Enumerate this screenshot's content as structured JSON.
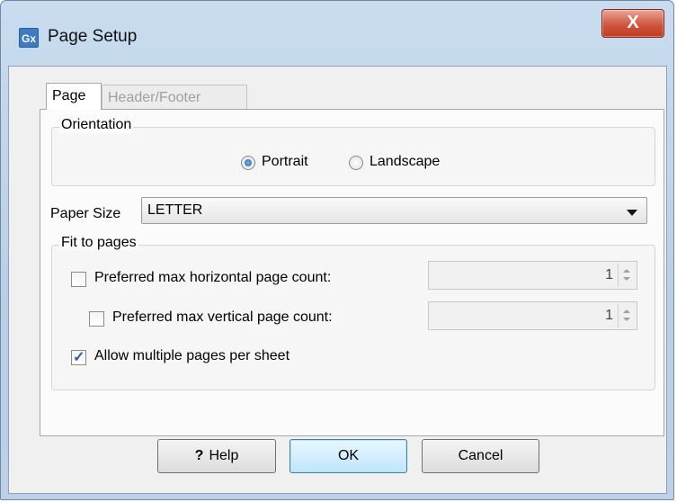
{
  "window": {
    "icon_text": "Gx",
    "title": "Page Setup",
    "close_label": "X"
  },
  "tabs": [
    {
      "label": "Page",
      "active": true
    },
    {
      "label": "Header/Footer",
      "active": false
    }
  ],
  "orientation": {
    "group_label": "Orientation",
    "options": [
      {
        "label": "Portrait",
        "checked": true
      },
      {
        "label": "Landscape",
        "checked": false
      }
    ]
  },
  "paper_size": {
    "label": "Paper Size",
    "value": "LETTER"
  },
  "fit_to_pages": {
    "group_label": "Fit to pages",
    "horizontal": {
      "label": "Preferred max horizontal page count:",
      "checked": false,
      "value": "1"
    },
    "vertical": {
      "label": "Preferred max vertical page count:",
      "checked": false,
      "value": "1"
    },
    "multiple": {
      "label": "Allow multiple pages per sheet",
      "checked": true,
      "mark": "✓"
    }
  },
  "buttons": {
    "help": "Help",
    "help_icon": "?",
    "ok": "OK",
    "cancel": "Cancel"
  },
  "colors": {
    "frame": "#c4d8ee",
    "close": "#c94a32",
    "default_button": "#bee6fd"
  }
}
